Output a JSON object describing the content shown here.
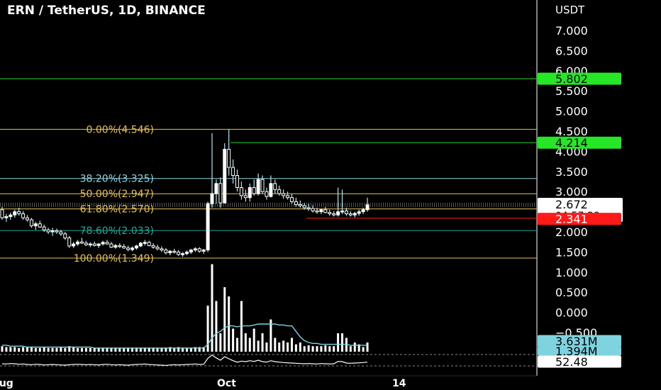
{
  "header": {
    "title": "ERN / TetherUS, 1D, BINANCE"
  },
  "price_axis": {
    "currency": "USDT",
    "ticks": [
      "7.000",
      "6.500",
      "6.000",
      "5.500",
      "5.000",
      "4.500",
      "4.000",
      "3.500",
      "3.000",
      "2.500",
      "2.000",
      "1.500",
      "1.000",
      "0.500",
      "0.000",
      "−0.500"
    ]
  },
  "time_axis": {
    "labels": [
      "Aug",
      "Oct",
      "14"
    ]
  },
  "badges": {
    "resistance_high": "5.802",
    "resistance_mid": "4.214",
    "last_price": "2.672",
    "countdown": "04:57:29",
    "support": "2.341",
    "volume": "3.631M",
    "volume_ma": "1.394M",
    "oscillator": "52.48"
  },
  "colors": {
    "background": "#000000",
    "candle": "#ffffff",
    "wick": "#b7e4ef",
    "volume": "#ffffff",
    "volume_ma": "#7fd3df",
    "fib_gold": "#e5c15d",
    "fib_cyan": "#8fd6e3",
    "fib_green": "#26a69a",
    "resistance_line": "#2fd32f",
    "support_line": "#ff1a1a",
    "last_price_line": "#9a9a9a",
    "badge_green": "#27e627",
    "badge_red": "#ff1a1a",
    "badge_cyan": "#7fd3df",
    "axis_text": "#ffffff"
  },
  "chart_data": {
    "type": "candlestick",
    "title": "ERN / TetherUS, 1D, BINANCE",
    "y_unit": "USDT",
    "ylim": [
      -0.55,
      7.75
    ],
    "fib_levels": [
      {
        "label": "0.00%(4.546)",
        "value": 4.546,
        "style": "gold"
      },
      {
        "label": "38.20%(3.325)",
        "value": 3.325,
        "style": "cyan"
      },
      {
        "label": "50.00%(2.947)",
        "value": 2.947,
        "style": "gold"
      },
      {
        "label": "61.80%(2.570)",
        "value": 2.57,
        "style": "gold"
      },
      {
        "label": "78.60%(2.033)",
        "value": 2.033,
        "style": "green"
      },
      {
        "label": "100.00%(1.349)",
        "value": 1.349,
        "style": "gold"
      }
    ],
    "horizontal_lines": [
      {
        "value": 5.802,
        "style": "resistance"
      },
      {
        "value": 4.214,
        "style": "resistance"
      },
      {
        "value": 2.341,
        "style": "support"
      },
      {
        "value": 2.672,
        "style": "last"
      }
    ],
    "candles": [
      [
        2.55,
        2.62,
        2.3,
        2.35
      ],
      [
        2.35,
        2.45,
        2.25,
        2.38
      ],
      [
        2.38,
        2.48,
        2.3,
        2.42
      ],
      [
        2.42,
        2.55,
        2.35,
        2.5
      ],
      [
        2.5,
        2.6,
        2.4,
        2.45
      ],
      [
        2.45,
        2.52,
        2.3,
        2.35
      ],
      [
        2.35,
        2.42,
        2.25,
        2.3
      ],
      [
        2.3,
        2.35,
        2.1,
        2.15
      ],
      [
        2.15,
        2.25,
        2.05,
        2.2
      ],
      [
        2.2,
        2.28,
        2.1,
        2.12
      ],
      [
        2.12,
        2.18,
        2.0,
        2.05
      ],
      [
        2.05,
        2.1,
        1.95,
        2.0
      ],
      [
        2.0,
        2.1,
        1.9,
        2.03
      ],
      [
        2.03,
        2.08,
        1.95,
        2.0
      ],
      [
        2.0,
        2.05,
        1.9,
        1.95
      ],
      [
        1.95,
        2.0,
        1.8,
        1.85
      ],
      [
        1.85,
        1.9,
        1.6,
        1.65
      ],
      [
        1.65,
        1.75,
        1.6,
        1.7
      ],
      [
        1.7,
        1.8,
        1.65,
        1.75
      ],
      [
        1.75,
        1.85,
        1.7,
        1.72
      ],
      [
        1.72,
        1.78,
        1.65,
        1.68
      ],
      [
        1.68,
        1.74,
        1.62,
        1.7
      ],
      [
        1.7,
        1.76,
        1.64,
        1.66
      ],
      [
        1.66,
        1.72,
        1.6,
        1.7
      ],
      [
        1.7,
        1.78,
        1.66,
        1.74
      ],
      [
        1.74,
        1.8,
        1.68,
        1.7
      ],
      [
        1.7,
        1.75,
        1.6,
        1.62
      ],
      [
        1.62,
        1.7,
        1.58,
        1.66
      ],
      [
        1.66,
        1.72,
        1.6,
        1.64
      ],
      [
        1.64,
        1.7,
        1.58,
        1.6
      ],
      [
        1.6,
        1.66,
        1.52,
        1.56
      ],
      [
        1.56,
        1.64,
        1.52,
        1.6
      ],
      [
        1.6,
        1.68,
        1.56,
        1.65
      ],
      [
        1.65,
        1.75,
        1.62,
        1.72
      ],
      [
        1.72,
        1.8,
        1.66,
        1.74
      ],
      [
        1.74,
        1.78,
        1.64,
        1.66
      ],
      [
        1.66,
        1.72,
        1.58,
        1.62
      ],
      [
        1.62,
        1.68,
        1.54,
        1.58
      ],
      [
        1.58,
        1.64,
        1.5,
        1.55
      ],
      [
        1.55,
        1.6,
        1.44,
        1.48
      ],
      [
        1.48,
        1.55,
        1.42,
        1.52
      ],
      [
        1.52,
        1.58,
        1.46,
        1.5
      ],
      [
        1.5,
        1.55,
        1.4,
        1.44
      ],
      [
        1.44,
        1.5,
        1.38,
        1.46
      ],
      [
        1.46,
        1.54,
        1.42,
        1.5
      ],
      [
        1.5,
        1.58,
        1.45,
        1.55
      ],
      [
        1.55,
        1.62,
        1.5,
        1.58
      ],
      [
        1.58,
        1.62,
        1.48,
        1.52
      ],
      [
        1.52,
        1.58,
        1.45,
        1.55
      ],
      [
        1.55,
        2.75,
        1.5,
        2.7
      ],
      [
        2.7,
        4.45,
        2.6,
        2.95
      ],
      [
        2.95,
        3.3,
        2.7,
        3.2
      ],
      [
        3.2,
        3.35,
        2.6,
        2.72
      ],
      [
        2.72,
        4.2,
        2.7,
        4.05
      ],
      [
        4.05,
        4.55,
        3.4,
        3.6
      ],
      [
        3.6,
        3.8,
        3.2,
        3.4
      ],
      [
        3.4,
        3.55,
        3.0,
        3.1
      ],
      [
        3.1,
        3.25,
        2.8,
        2.9
      ],
      [
        2.9,
        3.05,
        2.75,
        2.85
      ],
      [
        2.85,
        3.2,
        2.75,
        3.1
      ],
      [
        3.1,
        3.3,
        2.9,
        2.95
      ],
      [
        2.95,
        3.45,
        2.9,
        3.3
      ],
      [
        3.3,
        3.4,
        2.95,
        3.0
      ],
      [
        3.0,
        3.1,
        2.8,
        2.88
      ],
      [
        2.88,
        3.4,
        2.85,
        3.2
      ],
      [
        3.2,
        3.3,
        2.95,
        3.05
      ],
      [
        3.05,
        3.15,
        2.9,
        2.95
      ],
      [
        2.95,
        3.05,
        2.82,
        2.9
      ],
      [
        2.9,
        3.0,
        2.8,
        2.85
      ],
      [
        2.85,
        2.95,
        2.7,
        2.75
      ],
      [
        2.75,
        2.85,
        2.62,
        2.68
      ],
      [
        2.68,
        2.78,
        2.6,
        2.65
      ],
      [
        2.65,
        2.72,
        2.55,
        2.6
      ],
      [
        2.6,
        2.7,
        2.52,
        2.58
      ],
      [
        2.58,
        2.66,
        2.48,
        2.52
      ],
      [
        2.52,
        2.6,
        2.45,
        2.5
      ],
      [
        2.5,
        2.58,
        2.44,
        2.55
      ],
      [
        2.55,
        2.62,
        2.46,
        2.48
      ],
      [
        2.48,
        2.55,
        2.4,
        2.45
      ],
      [
        2.45,
        2.52,
        2.38,
        2.42
      ],
      [
        2.42,
        3.1,
        2.38,
        2.5
      ],
      [
        2.5,
        3.05,
        2.44,
        2.52
      ],
      [
        2.52,
        2.6,
        2.4,
        2.45
      ],
      [
        2.45,
        2.52,
        2.38,
        2.42
      ],
      [
        2.42,
        2.5,
        2.36,
        2.46
      ],
      [
        2.46,
        2.55,
        2.4,
        2.5
      ],
      [
        2.5,
        2.6,
        2.44,
        2.55
      ],
      [
        2.55,
        2.85,
        2.5,
        2.672
      ]
    ],
    "volume_values": [
      0.06,
      0.05,
      0.05,
      0.05,
      0.04,
      0.05,
      0.05,
      0.05,
      0.04,
      0.04,
      0.05,
      0.04,
      0.04,
      0.04,
      0.05,
      0.04,
      0.06,
      0.05,
      0.04,
      0.04,
      0.04,
      0.04,
      0.04,
      0.04,
      0.04,
      0.04,
      0.04,
      0.04,
      0.04,
      0.04,
      0.04,
      0.04,
      0.04,
      0.04,
      0.04,
      0.04,
      0.04,
      0.04,
      0.04,
      0.04,
      0.05,
      0.04,
      0.05,
      0.04,
      0.04,
      0.04,
      0.05,
      0.05,
      0.05,
      0.5,
      0.95,
      0.55,
      0.2,
      0.7,
      0.6,
      0.25,
      0.15,
      0.55,
      0.2,
      0.15,
      0.25,
      0.12,
      0.2,
      0.1,
      0.35,
      0.15,
      0.1,
      0.12,
      0.1,
      0.15,
      0.08,
      0.1,
      0.06,
      0.07,
      0.06,
      0.06,
      0.06,
      0.07,
      0.06,
      0.06,
      0.2,
      0.2,
      0.15,
      0.06,
      0.1,
      0.08,
      0.05,
      0.1
    ],
    "volume_ma_values": [
      0.07,
      0.07,
      0.06,
      0.06,
      0.06,
      0.06,
      0.05,
      0.05,
      0.05,
      0.05,
      0.05,
      0.05,
      0.05,
      0.05,
      0.05,
      0.05,
      0.05,
      0.05,
      0.05,
      0.05,
      0.05,
      0.05,
      0.04,
      0.04,
      0.04,
      0.04,
      0.04,
      0.04,
      0.04,
      0.04,
      0.04,
      0.04,
      0.04,
      0.04,
      0.04,
      0.04,
      0.04,
      0.04,
      0.04,
      0.04,
      0.04,
      0.04,
      0.04,
      0.04,
      0.04,
      0.04,
      0.04,
      0.04,
      0.04,
      0.08,
      0.15,
      0.2,
      0.22,
      0.26,
      0.28,
      0.28,
      0.27,
      0.28,
      0.28,
      0.28,
      0.29,
      0.3,
      0.3,
      0.3,
      0.3,
      0.3,
      0.29,
      0.29,
      0.28,
      0.28,
      0.22,
      0.16,
      0.12,
      0.1,
      0.09,
      0.09,
      0.08,
      0.08,
      0.08,
      0.08,
      0.08,
      0.08,
      0.08,
      0.07,
      0.07,
      0.07,
      0.07,
      0.07
    ],
    "oscillator_values": [
      45,
      44,
      46,
      45,
      43,
      44,
      42,
      41,
      43,
      42,
      40,
      41,
      42,
      41,
      40,
      39,
      41,
      42,
      43,
      42,
      41,
      42,
      41,
      40,
      42,
      43,
      41,
      40,
      41,
      40,
      39,
      41,
      42,
      43,
      44,
      42,
      41,
      40,
      39,
      38,
      40,
      41,
      40,
      41,
      42,
      43,
      44,
      42,
      43,
      68,
      82,
      70,
      60,
      75,
      66,
      58,
      52,
      56,
      54,
      58,
      55,
      60,
      54,
      52,
      58,
      54,
      52,
      50,
      49,
      48,
      47,
      46,
      45,
      46,
      45,
      44,
      46,
      45,
      44,
      45,
      55,
      54,
      48,
      47,
      48,
      49,
      50,
      52
    ]
  }
}
